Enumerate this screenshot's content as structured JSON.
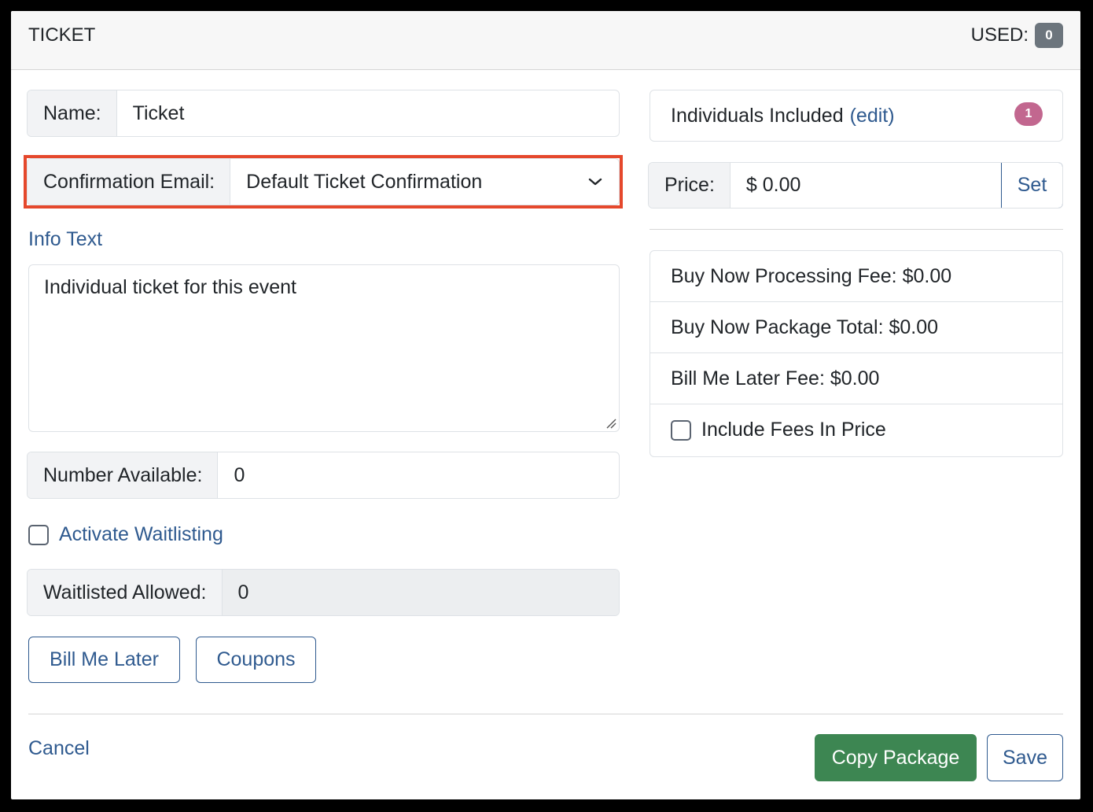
{
  "header": {
    "title": "TICKET",
    "used_label": "USED:",
    "used_count": "0"
  },
  "form": {
    "name_label": "Name:",
    "name_value": "Ticket",
    "confirmation_label": "Confirmation Email:",
    "confirmation_value": "Default Ticket Confirmation",
    "info_text_label": "Info Text",
    "info_text_value": "Individual ticket for this event",
    "number_available_label": "Number Available:",
    "number_available_value": "0",
    "waitlist_checkbox_label": "Activate Waitlisting",
    "waitlisted_allowed_label": "Waitlisted Allowed:",
    "waitlisted_allowed_value": "0",
    "bill_me_later_button": "Bill Me Later",
    "coupons_button": "Coupons"
  },
  "right": {
    "individuals_label": "Individuals Included",
    "individuals_edit": "(edit)",
    "individuals_count": "1",
    "price_label": "Price:",
    "price_value": "$ 0.00",
    "set_button": "Set",
    "fees": [
      "Buy Now Processing Fee: $0.00",
      "Buy Now Package Total: $0.00",
      "Bill Me Later Fee: $0.00"
    ],
    "include_fees_label": "Include Fees In Price"
  },
  "footer": {
    "cancel": "Cancel",
    "copy_package": "Copy Package",
    "save": "Save"
  },
  "colors": {
    "link": "#2f5a8f",
    "success": "#3d8652",
    "highlight": "#e5482c",
    "pill": "#c2678f"
  },
  "icons": {
    "dropdown": "chevron-down-icon",
    "resize": "resize-grip-icon"
  }
}
